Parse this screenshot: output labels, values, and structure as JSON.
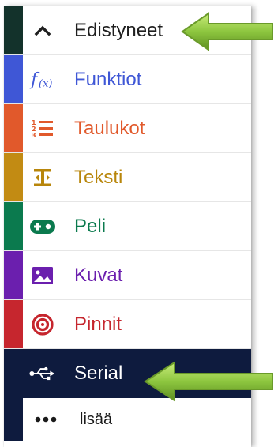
{
  "categories": [
    {
      "label": "Edistyneet",
      "color": "#1f1f1f",
      "stripe": "#13322b",
      "icon": "chevron-up-icon"
    },
    {
      "label": "Funktiot",
      "color": "#3f57d6",
      "stripe": "#3f57d6",
      "icon": "function-icon"
    },
    {
      "label": "Taulukot",
      "color": "#e1592b",
      "stripe": "#e1592b",
      "icon": "list-icon"
    },
    {
      "label": "Teksti",
      "color": "#b8860b",
      "stripe": "#c28b13",
      "icon": "text-icon"
    },
    {
      "label": "Peli",
      "color": "#0b7a4e",
      "stripe": "#0b7a4e",
      "icon": "gamepad-icon"
    },
    {
      "label": "Kuvat",
      "color": "#6b1fae",
      "stripe": "#6b1fae",
      "icon": "image-icon"
    },
    {
      "label": "Pinnit",
      "color": "#c6262e",
      "stripe": "#c6262e",
      "icon": "target-icon"
    },
    {
      "label": "Serial",
      "color": "#ffffff",
      "stripe": "#0e1b3e",
      "icon": "usb-icon"
    }
  ],
  "more": {
    "label": "lisää",
    "icon": "more-dots-icon"
  },
  "colors": {
    "selected_bg": "#0e1b3e",
    "arrow_fill": "#8dc63f",
    "arrow_stroke": "#6a9a2a"
  }
}
